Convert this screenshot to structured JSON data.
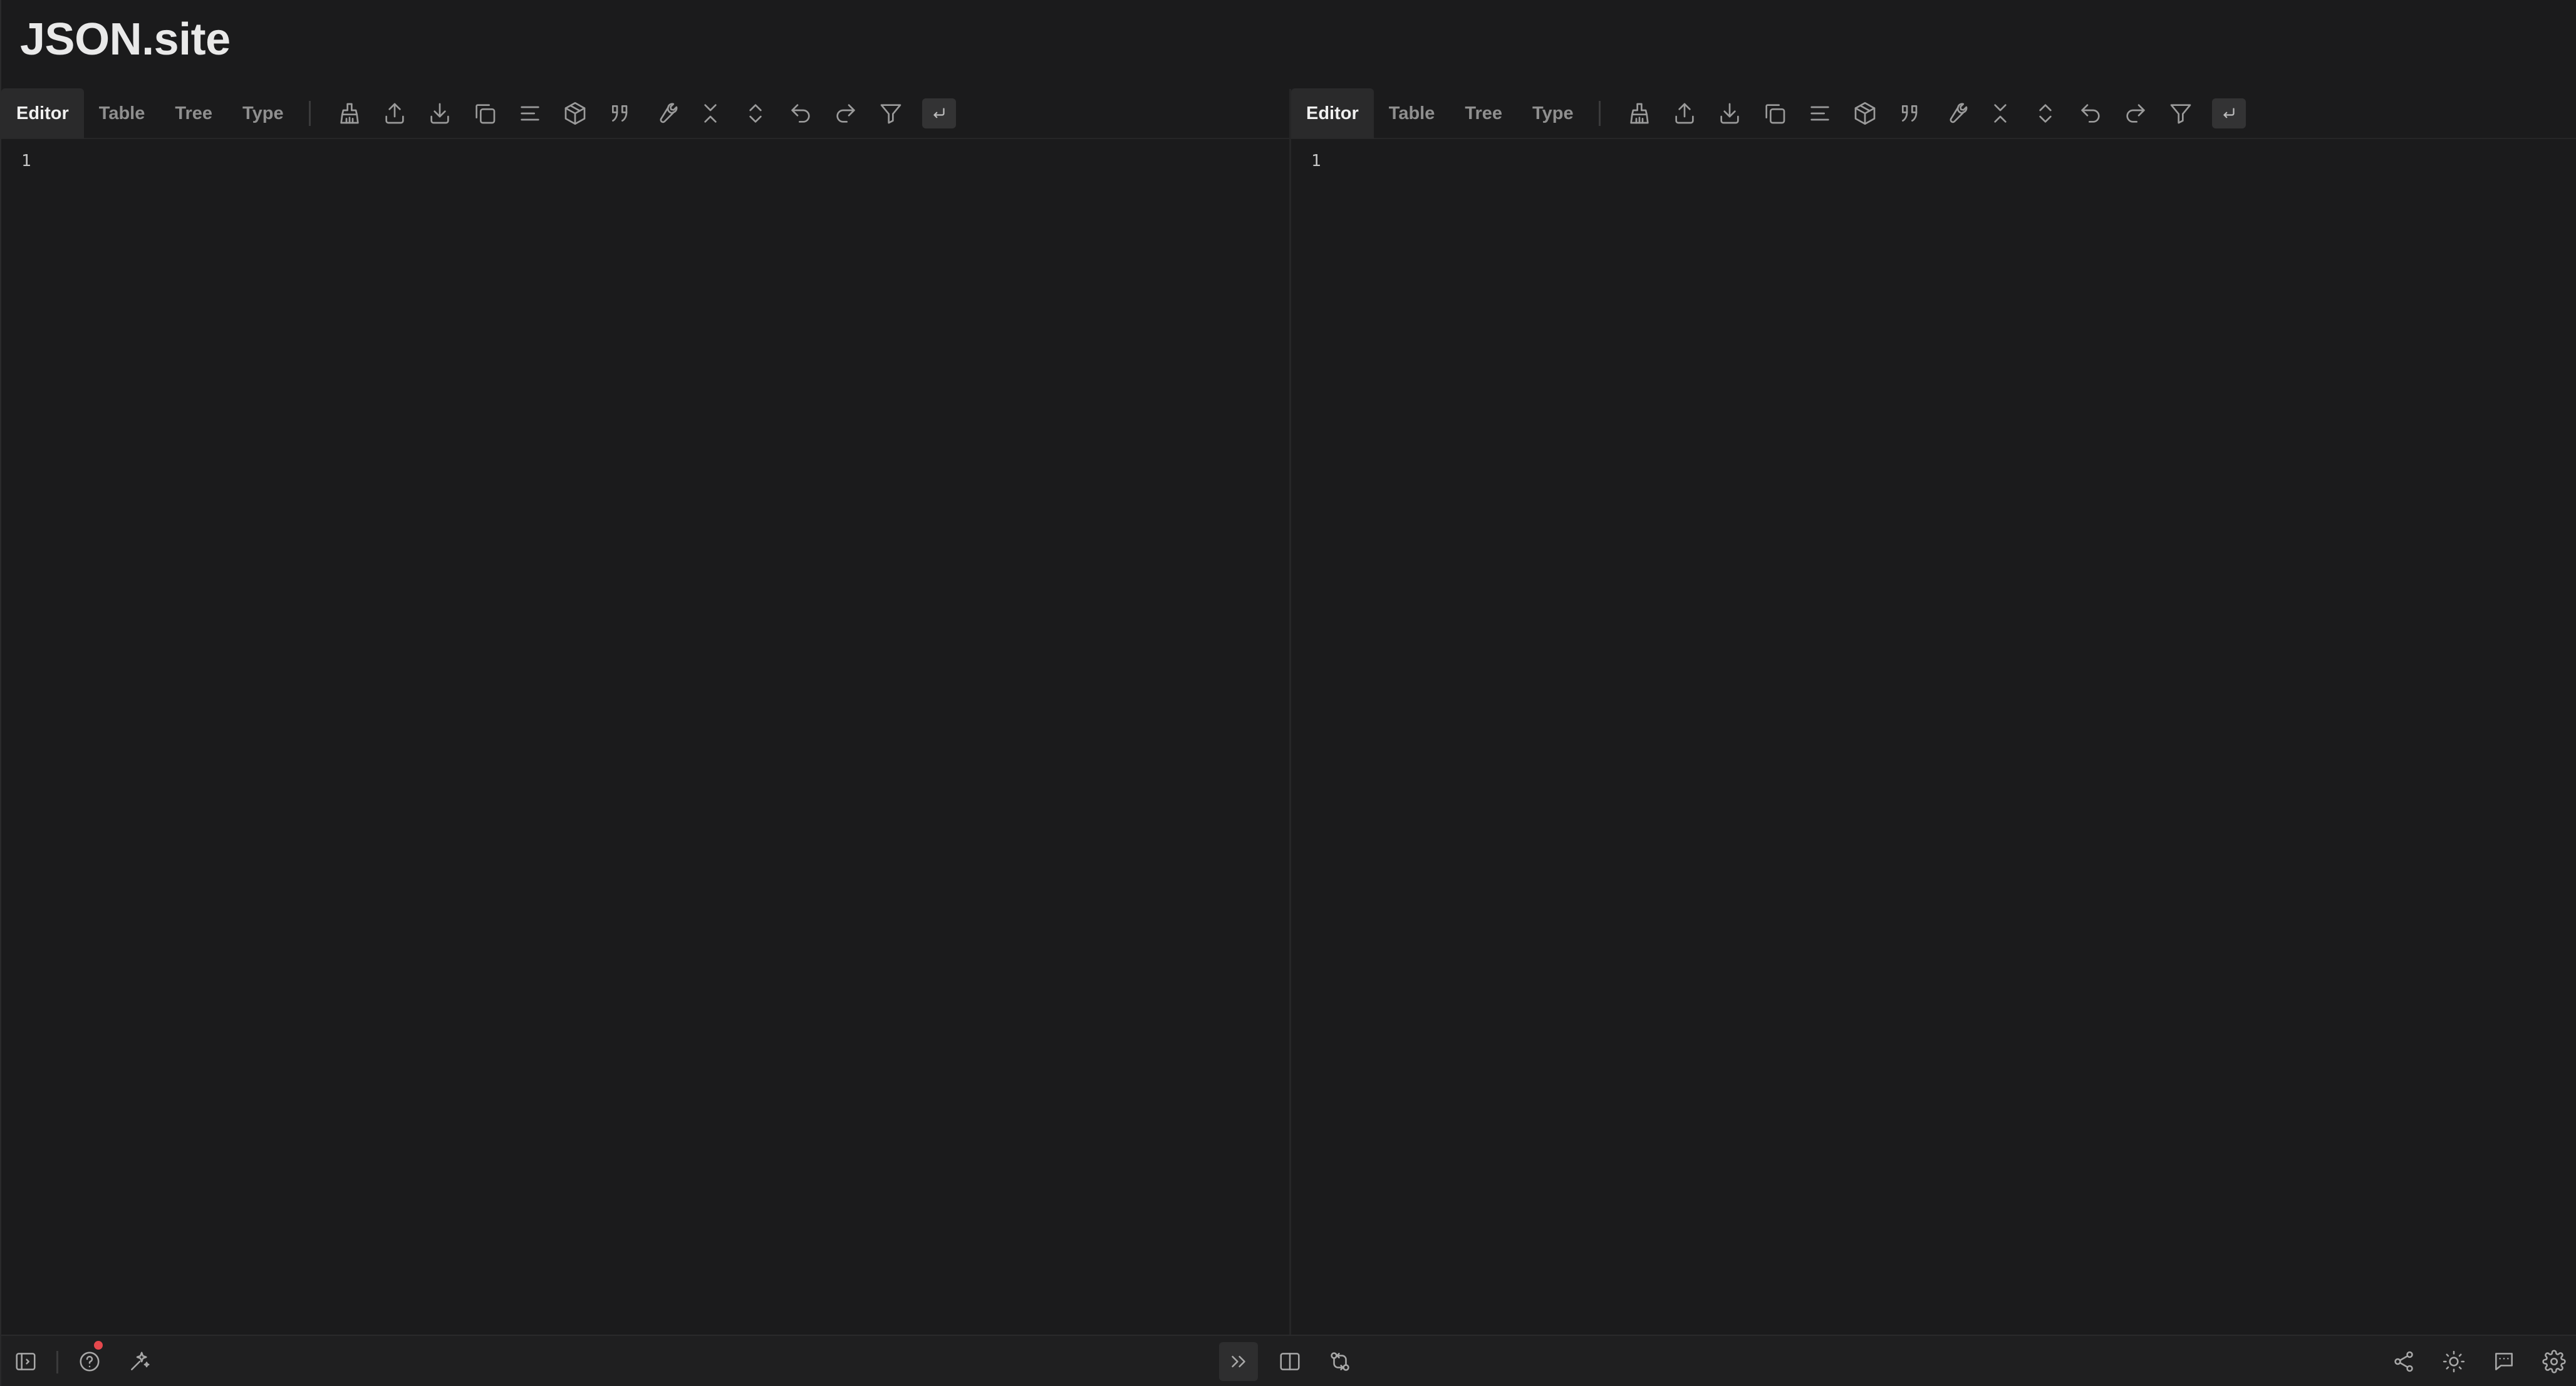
{
  "app": {
    "title": "JSON.site"
  },
  "panels": [
    {
      "tabs": [
        {
          "label": "Editor",
          "active": true
        },
        {
          "label": "Table",
          "active": false
        },
        {
          "label": "Tree",
          "active": false
        },
        {
          "label": "Type",
          "active": false
        }
      ],
      "toolbar_icons": [
        "clear-icon",
        "upload-icon",
        "download-icon",
        "copy-icon",
        "format-icon",
        "package-icon",
        "quote-icon",
        "wrench-icon",
        "collapse-all-icon",
        "expand-all-icon",
        "undo-icon",
        "redo-icon",
        "filter-icon",
        "word-wrap-icon"
      ],
      "line_numbers": [
        "1"
      ]
    },
    {
      "tabs": [
        {
          "label": "Editor",
          "active": true
        },
        {
          "label": "Table",
          "active": false
        },
        {
          "label": "Tree",
          "active": false
        },
        {
          "label": "Type",
          "active": false
        }
      ],
      "toolbar_icons": [
        "clear-icon",
        "upload-icon",
        "download-icon",
        "copy-icon",
        "format-icon",
        "package-icon",
        "quote-icon",
        "wrench-icon",
        "collapse-all-icon",
        "expand-all-icon",
        "undo-icon",
        "redo-icon",
        "filter-icon",
        "word-wrap-icon"
      ],
      "line_numbers": [
        "1"
      ]
    }
  ],
  "status_bar": {
    "left_icons": [
      "sidebar-toggle-icon",
      "help-icon",
      "ai-sparkle-icon"
    ],
    "center_icons": [
      "transfer-right-icon",
      "split-view-icon",
      "compare-icon"
    ],
    "right_icons": [
      "share-icon",
      "theme-icon",
      "feedback-icon",
      "settings-icon"
    ],
    "notification_color": "#e5484d"
  },
  "colors": {
    "background": "#1b1b1c",
    "active_tab": "#2a2a2b",
    "text": "#d4d4d4"
  }
}
